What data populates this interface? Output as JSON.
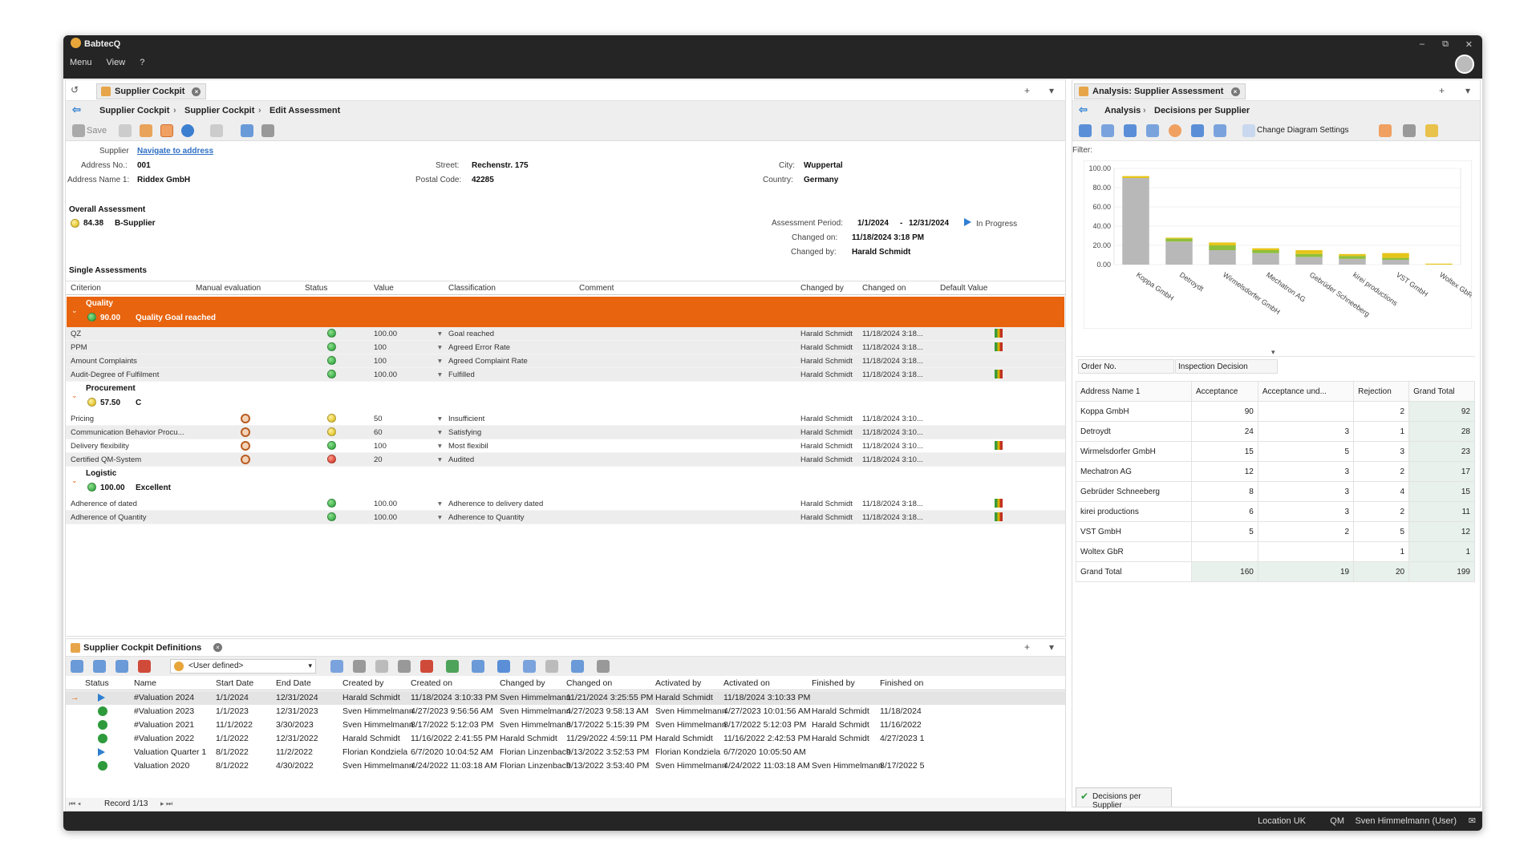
{
  "app": {
    "title": "BabtecQ",
    "menu": [
      "Menu",
      "View",
      "?"
    ],
    "controls": [
      "–",
      "⧉",
      "✕"
    ]
  },
  "left_pane": {
    "tab": "Supplier Cockpit",
    "breadcrumb": [
      "Supplier Cockpit",
      "Supplier Cockpit",
      "Edit Assessment"
    ],
    "toolbar": {
      "save": "Save"
    },
    "supplier": {
      "label": "Supplier",
      "link": "Navigate to address"
    },
    "address": {
      "no_label": "Address No.:",
      "no": "001",
      "name_label": "Address Name 1:",
      "name": "Riddex GmbH",
      "street_label": "Street:",
      "street": "Rechenstr. 175",
      "postal_label": "Postal Code:",
      "postal": "42285",
      "city_label": "City:",
      "city": "Wuppertal",
      "country_label": "Country:",
      "country": "Germany"
    },
    "overall": {
      "title": "Overall Assessment",
      "score": "84.38",
      "class": "B-Supplier",
      "period_label": "Assessment Period:",
      "period_from": "1/1/2024",
      "period_sep": "-",
      "period_to": "12/31/2024",
      "status": "In Progress",
      "changed_on_label": "Changed on:",
      "changed_on": "11/18/2024 3:18 PM",
      "changed_by_label": "Changed by:",
      "changed_by": "Harald Schmidt"
    },
    "single": {
      "title": "Single Assessments",
      "columns": [
        "Criterion",
        "Manual evaluation",
        "Status",
        "Value",
        "Classification",
        "Comment",
        "Changed by",
        "Changed on",
        "Default Value"
      ],
      "groups": [
        {
          "name": "Quality",
          "score": "90.00",
          "label": "Quality Goal reached",
          "status": "green",
          "rows": [
            {
              "criterion": "QZ",
              "manual": false,
              "status": "green",
              "value": "100.00",
              "classification": "Goal reached",
              "changed_by": "Harald Schmidt",
              "changed_on": "11/18/2024 3:18...",
              "flag": true
            },
            {
              "criterion": "PPM",
              "manual": false,
              "status": "green",
              "value": "100",
              "classification": "Agreed Error Rate",
              "changed_by": "Harald Schmidt",
              "changed_on": "11/18/2024 3:18...",
              "flag": true
            },
            {
              "criterion": "Amount Complaints",
              "manual": false,
              "status": "green",
              "value": "100",
              "classification": "Agreed Complaint Rate",
              "changed_by": "Harald Schmidt",
              "changed_on": "11/18/2024 3:18...",
              "flag": false
            },
            {
              "criterion": "Audit-Degree of Fulfilment",
              "manual": false,
              "status": "green",
              "value": "100.00",
              "classification": "Fulfilled",
              "changed_by": "Harald Schmidt",
              "changed_on": "11/18/2024 3:18...",
              "flag": true
            }
          ]
        },
        {
          "name": "Procurement",
          "score": "57.50",
          "label": "C",
          "status": "yellow",
          "rows": [
            {
              "criterion": "Pricing",
              "manual": true,
              "status": "yellow",
              "value": "50",
              "classification": "Insufficient",
              "changed_by": "Harald Schmidt",
              "changed_on": "11/18/2024 3:10...",
              "flag": false
            },
            {
              "criterion": "Communication Behavior Procu...",
              "manual": true,
              "status": "yellow",
              "value": "60",
              "classification": "Satisfying",
              "changed_by": "Harald Schmidt",
              "changed_on": "11/18/2024 3:10...",
              "flag": false
            },
            {
              "criterion": "Delivery flexibility",
              "manual": true,
              "status": "green",
              "value": "100",
              "classification": "Most flexibil",
              "changed_by": "Harald Schmidt",
              "changed_on": "11/18/2024 3:10...",
              "flag": true
            },
            {
              "criterion": "Certified QM-System",
              "manual": true,
              "status": "red",
              "value": "20",
              "classification": "Audited",
              "changed_by": "Harald Schmidt",
              "changed_on": "11/18/2024 3:10...",
              "flag": false
            }
          ]
        },
        {
          "name": "Logistic",
          "score": "100.00",
          "label": "Excellent",
          "status": "green",
          "rows": [
            {
              "criterion": "Adherence of dated",
              "manual": false,
              "status": "green",
              "value": "100.00",
              "classification": "Adherence to delivery dated",
              "changed_by": "Harald Schmidt",
              "changed_on": "11/18/2024 3:18...",
              "flag": true
            },
            {
              "criterion": "Adherence of Quantity",
              "manual": false,
              "status": "green",
              "value": "100.00",
              "classification": "Adherence to Quantity",
              "changed_by": "Harald Schmidt",
              "changed_on": "11/18/2024 3:18...",
              "flag": true
            }
          ]
        }
      ]
    }
  },
  "right_pane": {
    "tab": "Analysis: Supplier Assessment",
    "breadcrumb": [
      "Analysis",
      "Decisions per Supplier"
    ],
    "toolbar": {
      "diagram_settings": "Change Diagram Settings"
    },
    "filter_label": "Filter:",
    "order_label": "Order No.",
    "inspection_label": "Inspection Decision",
    "pivot": {
      "columns": [
        "Address Name 1",
        "Acceptance",
        "Acceptance und...",
        "Rejection",
        "Grand Total"
      ],
      "rows": [
        [
          "Koppa GmbH",
          "90",
          "",
          "2",
          "92"
        ],
        [
          "Detroydt",
          "24",
          "3",
          "1",
          "28"
        ],
        [
          "Wirmelsdorfer GmbH",
          "15",
          "5",
          "3",
          "23"
        ],
        [
          "Mechatron AG",
          "12",
          "3",
          "2",
          "17"
        ],
        [
          "Gebrüder Schneeberg",
          "8",
          "3",
          "4",
          "15"
        ],
        [
          "kirei productions",
          "6",
          "3",
          "2",
          "11"
        ],
        [
          "VST GmbH",
          "5",
          "2",
          "5",
          "12"
        ],
        [
          "Woltex GbR",
          "",
          "",
          "1",
          "1"
        ],
        [
          "Grand Total",
          "160",
          "19",
          "20",
          "199"
        ]
      ]
    },
    "bottom_tab": "Decisions per Supplier"
  },
  "chart_data": {
    "type": "bar",
    "stacked": true,
    "categories": [
      "Koppa GmbH",
      "Detroydt",
      "Wirmelsdorfer GmbH",
      "Mechatron AG",
      "Gebrüder Schneeberg",
      "kirei productions",
      "VST GmbH",
      "Woltex GbR"
    ],
    "series": [
      {
        "values": [
          90,
          24,
          15,
          12,
          8,
          6,
          5,
          0
        ],
        "color": "#b8b8b8"
      },
      {
        "values": [
          0,
          3,
          5,
          3,
          3,
          3,
          2,
          0
        ],
        "color": "#8fbf3a"
      },
      {
        "values": [
          2,
          1,
          3,
          2,
          4,
          2,
          5,
          1
        ],
        "color": "#e6c51a"
      }
    ],
    "yticks": [
      "100.00",
      "80.00",
      "60.00",
      "40.00",
      "20.00",
      "0.00"
    ],
    "ylim": [
      0,
      100
    ]
  },
  "defs_pane": {
    "tab": "Supplier Cockpit Definitions",
    "filter": "<User defined>",
    "columns": [
      "Status",
      "Name",
      "Start Date",
      "End Date",
      "Created by",
      "Created on",
      "Changed by",
      "Changed on",
      "Activated by",
      "Activated on",
      "Finished by",
      "Finished on"
    ],
    "rows": [
      {
        "status": "play",
        "name": "#Valuation 2024",
        "start": "1/1/2024",
        "end": "12/31/2024",
        "created_by": "Harald Schmidt",
        "created_on": "11/18/2024 3:10:33 PM",
        "changed_by": "Sven Himmelmann",
        "changed_on": "11/21/2024 3:25:55 PM",
        "activated_by": "Harald Schmidt",
        "activated_on": "11/18/2024 3:10:33 PM",
        "finished_by": "",
        "finished_on": ""
      },
      {
        "status": "done",
        "name": "#Valuation 2023",
        "start": "1/1/2023",
        "end": "12/31/2023",
        "created_by": "Sven Himmelmann",
        "created_on": "4/27/2023 9:56:56 AM",
        "changed_by": "Sven Himmelmann",
        "changed_on": "4/27/2023 9:58:13 AM",
        "activated_by": "Sven Himmelmann",
        "activated_on": "4/27/2023 10:01:56 AM",
        "finished_by": "Harald Schmidt",
        "finished_on": "11/18/2024"
      },
      {
        "status": "done",
        "name": "#Valuation 2021",
        "start": "11/1/2022",
        "end": "3/30/2023",
        "created_by": "Sven Himmelmann",
        "created_on": "8/17/2022 5:12:03 PM",
        "changed_by": "Sven Himmelmann",
        "changed_on": "8/17/2022 5:15:39 PM",
        "activated_by": "Sven Himmelmann",
        "activated_on": "8/17/2022 5:12:03 PM",
        "finished_by": "Harald Schmidt",
        "finished_on": "11/16/2022"
      },
      {
        "status": "done",
        "name": "#Valuation 2022",
        "start": "1/1/2022",
        "end": "12/31/2022",
        "created_by": "Harald Schmidt",
        "created_on": "11/16/2022 2:41:55 PM",
        "changed_by": "Harald Schmidt",
        "changed_on": "11/29/2022 4:59:11 PM",
        "activated_by": "Harald Schmidt",
        "activated_on": "11/16/2022 2:42:53 PM",
        "finished_by": "Harald Schmidt",
        "finished_on": "4/27/2023 1"
      },
      {
        "status": "play",
        "name": "Valuation Quarter 1",
        "start": "8/1/2022",
        "end": "11/2/2022",
        "created_by": "Florian Kondziela",
        "created_on": "6/7/2020 10:04:52 AM",
        "changed_by": "Florian Linzenbach",
        "changed_on": "9/13/2022 3:52:53 PM",
        "activated_by": "Florian Kondziela",
        "activated_on": "6/7/2020 10:05:50 AM",
        "finished_by": "",
        "finished_on": ""
      },
      {
        "status": "done",
        "name": "Valuation 2020",
        "start": "8/1/2022",
        "end": "4/30/2022",
        "created_by": "Sven Himmelmann",
        "created_on": "4/24/2022 11:03:18 AM",
        "changed_by": "Florian Linzenbach",
        "changed_on": "9/13/2022 3:53:40 PM",
        "activated_by": "Sven Himmelmann",
        "activated_on": "4/24/2022 11:03:18 AM",
        "finished_by": "Sven Himmelmann",
        "finished_on": "8/17/2022 5"
      }
    ],
    "record": "Record 1/13"
  },
  "statusbar": {
    "location": "Location UK",
    "module": "QM",
    "user": "Sven Himmelmann (User)"
  }
}
